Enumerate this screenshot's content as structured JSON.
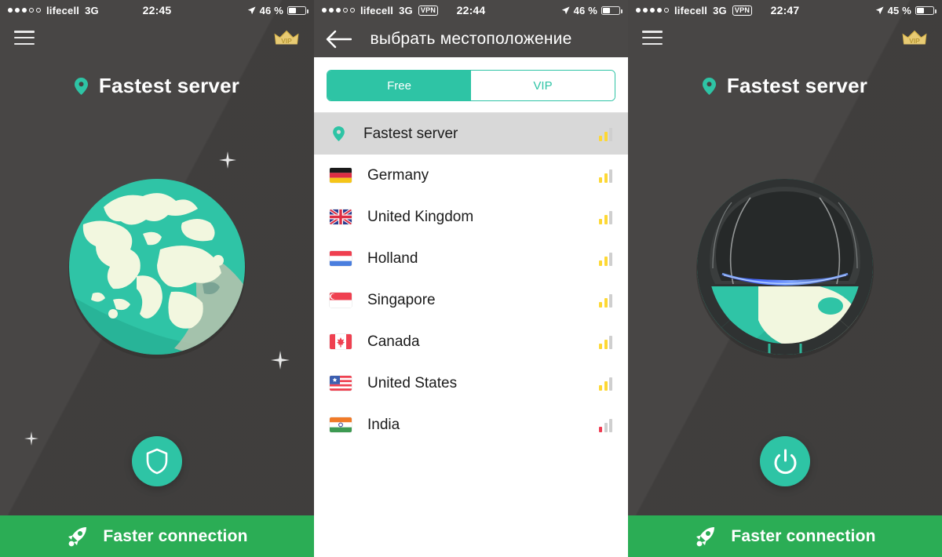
{
  "colors": {
    "dark_bg": "#444241",
    "teal": "#2ec4a5",
    "green_bar": "#2bad55",
    "crown_gold": "#d8b44a",
    "signal_yellow": "#fdd835",
    "signal_gray": "#dcdcdc",
    "signal_red": "#ef3b52",
    "selected_row": "#d8d8d8"
  },
  "screens": [
    {
      "id": "home-disconnected",
      "statusbar": {
        "signal_dots_filled": 3,
        "signal_dots_total": 5,
        "carrier": "lifecell",
        "network": "3G",
        "vpn_badge": "",
        "time": "22:45",
        "battery_percent": "46 %",
        "battery_level": 46
      },
      "nav": {
        "menu_icon": "hamburger-icon",
        "vip_label": "VIP"
      },
      "title": {
        "text": "Fastest server",
        "pin_icon": "location-pin-icon"
      },
      "globe": {
        "state": "unprotected"
      },
      "action_button": {
        "icon": "shield-icon",
        "state": "connect"
      },
      "bottombar": {
        "label": "Faster connection",
        "icon": "rocket-icon"
      }
    },
    {
      "id": "select-location",
      "statusbar": {
        "signal_dots_filled": 3,
        "signal_dots_total": 5,
        "carrier": "lifecell",
        "network": "3G",
        "vpn_badge": "VPN",
        "time": "22:44",
        "battery_percent": "46 %",
        "battery_level": 46
      },
      "nav": {
        "back_icon": "back-arrow-icon",
        "title": "выбрать местоположение"
      },
      "tabs": [
        {
          "label": "Free",
          "active": true
        },
        {
          "label": "VIP",
          "active": false
        }
      ],
      "servers": [
        {
          "name": "Fastest server",
          "icon": "location-pin-icon",
          "flag": null,
          "selected": true,
          "signal_bars": 2,
          "signal_quality": "good"
        },
        {
          "name": "Germany",
          "icon": null,
          "flag": "de",
          "selected": false,
          "signal_bars": 2,
          "signal_quality": "good"
        },
        {
          "name": "United Kingdom",
          "icon": null,
          "flag": "gb",
          "selected": false,
          "signal_bars": 2,
          "signal_quality": "good"
        },
        {
          "name": "Holland",
          "icon": null,
          "flag": "nl",
          "selected": false,
          "signal_bars": 2,
          "signal_quality": "good"
        },
        {
          "name": "Singapore",
          "icon": null,
          "flag": "sg",
          "selected": false,
          "signal_bars": 2,
          "signal_quality": "good"
        },
        {
          "name": "Canada",
          "icon": null,
          "flag": "ca",
          "selected": false,
          "signal_bars": 2,
          "signal_quality": "good"
        },
        {
          "name": "United States",
          "icon": null,
          "flag": "us",
          "selected": false,
          "signal_bars": 2,
          "signal_quality": "good"
        },
        {
          "name": "India",
          "icon": null,
          "flag": "in",
          "selected": false,
          "signal_bars": 1,
          "signal_quality": "poor"
        }
      ]
    },
    {
      "id": "home-connected",
      "statusbar": {
        "signal_dots_filled": 4,
        "signal_dots_total": 5,
        "carrier": "lifecell",
        "network": "3G",
        "vpn_badge": "VPN",
        "time": "22:47",
        "battery_percent": "45 %",
        "battery_level": 45
      },
      "nav": {
        "menu_icon": "hamburger-icon",
        "vip_label": "VIP"
      },
      "title": {
        "text": "Fastest server",
        "pin_icon": "location-pin-icon"
      },
      "globe": {
        "state": "protected"
      },
      "action_button": {
        "icon": "power-icon",
        "state": "disconnect"
      },
      "bottombar": {
        "label": "Faster connection",
        "icon": "rocket-icon"
      }
    }
  ]
}
